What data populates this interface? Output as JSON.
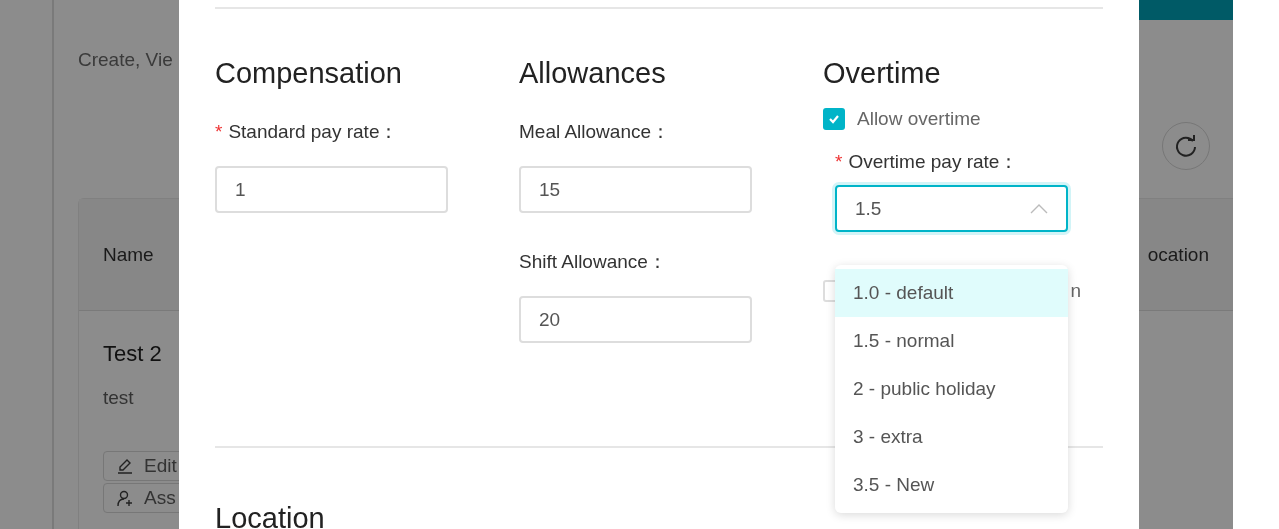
{
  "background_page": {
    "subtitle": "Create, Vie",
    "table": {
      "columns": [
        "Name",
        "ocation"
      ],
      "rows": [
        {
          "name": "Test 2",
          "description": "test",
          "actions": [
            "Edit",
            "Ass"
          ]
        }
      ]
    }
  },
  "modal": {
    "sections": [
      {
        "title": "Compensation",
        "fields": [
          {
            "required_mark": "*",
            "label": "Standard pay rate：",
            "value": "1"
          }
        ]
      },
      {
        "title": "Allowances",
        "fields": [
          {
            "label": "Meal Allowance：",
            "value": "15"
          },
          {
            "label": "Shift Allowance：",
            "value": "20"
          }
        ]
      }
    ],
    "overtime": {
      "title": "Overtime",
      "allow_overtime": {
        "label": "Allow overtime",
        "checked": true
      },
      "pay_rate": {
        "required_mark": "*",
        "label": "Overtime pay rate：",
        "value": "1.5",
        "expanded": true,
        "options": [
          {
            "label": "1.0 - default",
            "highlighted": true
          },
          {
            "label": "1.5 - normal",
            "highlighted": false
          },
          {
            "label": "2 - public holiday",
            "highlighted": false
          },
          {
            "label": "3 - extra",
            "highlighted": false
          },
          {
            "label": "3.5 - New",
            "highlighted": false
          }
        ]
      },
      "other_option": {
        "label": "n",
        "checked": false
      }
    },
    "next_section": "Location"
  }
}
